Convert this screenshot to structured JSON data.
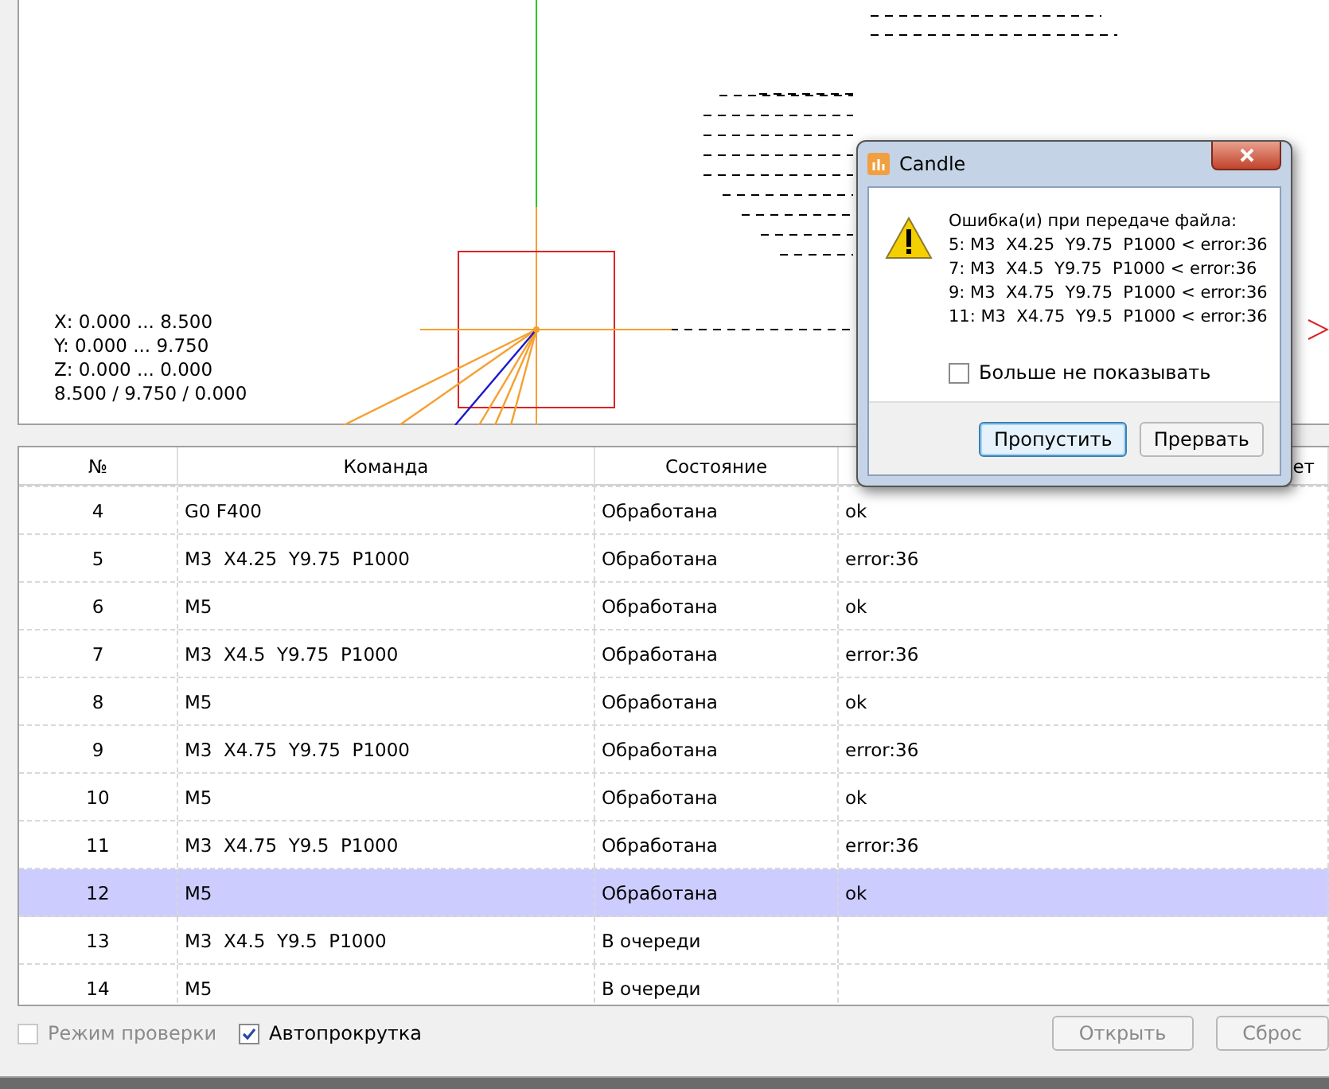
{
  "viewer": {
    "info": [
      "X: 0.000 ... 8.500",
      "Y: 0.000 ... 9.750",
      "Z: 0.000 ... 0.000",
      "8.500 / 9.750 / 0.000"
    ]
  },
  "table": {
    "columns": [
      "№",
      "Команда",
      "Состояние",
      "ет"
    ],
    "rows": [
      {
        "cells": [
          "4",
          "G0 F400",
          "Обработана",
          "ok"
        ],
        "selected": false
      },
      {
        "cells": [
          "5",
          "M3  X4.25  Y9.75  P1000",
          "Обработана",
          "error:36"
        ],
        "selected": false
      },
      {
        "cells": [
          "6",
          "M5",
          "Обработана",
          "ok"
        ],
        "selected": false
      },
      {
        "cells": [
          "7",
          "M3  X4.5  Y9.75  P1000",
          "Обработана",
          "error:36"
        ],
        "selected": false
      },
      {
        "cells": [
          "8",
          "M5",
          "Обработана",
          "ok"
        ],
        "selected": false
      },
      {
        "cells": [
          "9",
          "M3  X4.75  Y9.75  P1000",
          "Обработана",
          "error:36"
        ],
        "selected": false
      },
      {
        "cells": [
          "10",
          "M5",
          "Обработана",
          "ok"
        ],
        "selected": false
      },
      {
        "cells": [
          "11",
          "M3  X4.75  Y9.5  P1000",
          "Обработана",
          "error:36"
        ],
        "selected": false
      },
      {
        "cells": [
          "12",
          "M5",
          "Обработана",
          "ok"
        ],
        "selected": true
      },
      {
        "cells": [
          "13",
          "M3  X4.5  Y9.5  P1000",
          "В очереди",
          ""
        ],
        "selected": false
      },
      {
        "cells": [
          "14",
          "M5",
          "В очереди",
          ""
        ],
        "selected": false
      }
    ]
  },
  "options": [
    {
      "label": "Режим проверки",
      "checked": false,
      "disabled": true
    },
    {
      "label": "Автопрокрутка",
      "checked": true,
      "disabled": false
    }
  ],
  "buttons": [
    {
      "label": "Открыть",
      "disabled": true
    },
    {
      "label": "Сброс",
      "disabled": true
    }
  ],
  "dialog": {
    "title": "Candle",
    "message": [
      "Ошибка(и) при передаче файла:",
      "5: M3  X4.25  Y9.75  P1000 < error:36",
      "7: M3  X4.5  Y9.75  P1000 < error:36",
      "9: M3  X4.75  Y9.75  P1000 < error:36",
      "11: M3  X4.75  Y9.5  P1000 < error:36"
    ],
    "checkbox": {
      "label": "Больше не показывать",
      "checked": false
    },
    "buttons": [
      {
        "label": "Пропустить",
        "selected": true
      },
      {
        "label": "Прервать",
        "selected": false
      }
    ]
  }
}
